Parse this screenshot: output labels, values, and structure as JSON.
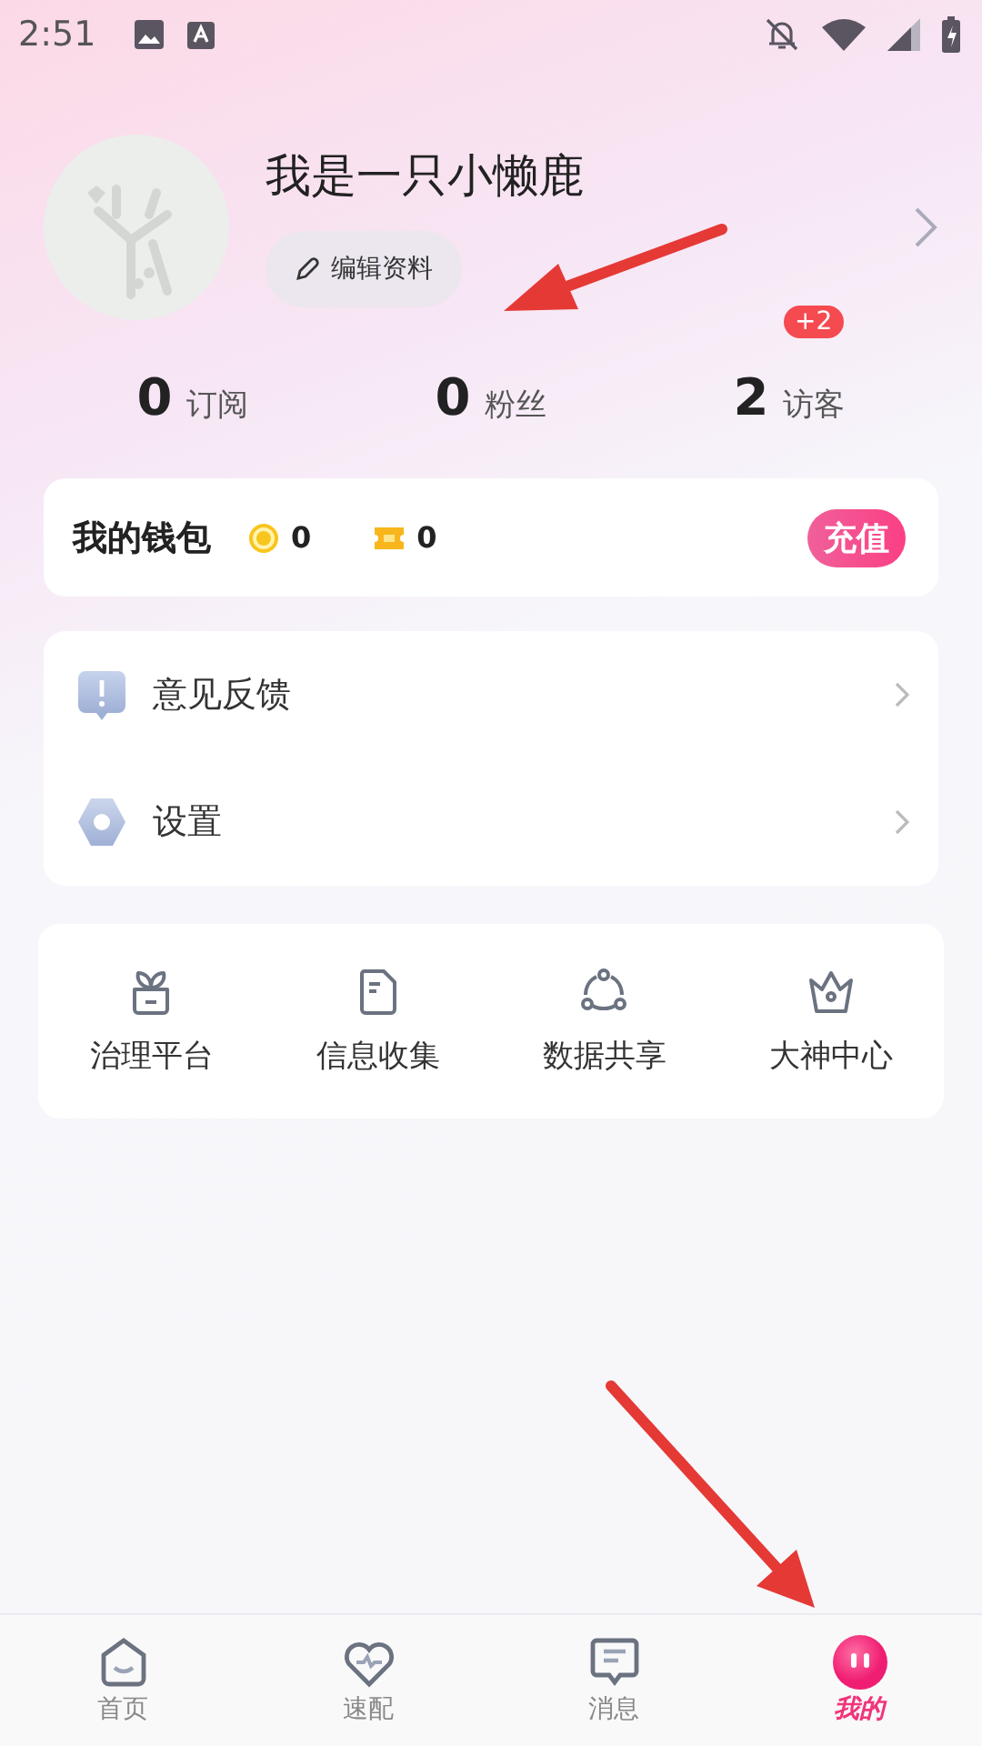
{
  "status_bar": {
    "time": "2:51"
  },
  "profile": {
    "name": "我是一只小懒鹿",
    "edit_button": "编辑资料"
  },
  "stats": [
    {
      "value": "0",
      "label": "订阅"
    },
    {
      "value": "0",
      "label": "粉丝"
    },
    {
      "value": "2",
      "label": "访客",
      "badge": "+2"
    }
  ],
  "wallet": {
    "title": "我的钱包",
    "balances": [
      {
        "kind": "coin",
        "value": "0"
      },
      {
        "kind": "ticket",
        "value": "0"
      }
    ],
    "button": "充值"
  },
  "menu": [
    {
      "kind": "feedback",
      "label": "意见反馈"
    },
    {
      "kind": "settings",
      "label": "设置"
    }
  ],
  "tools": [
    {
      "kind": "plant",
      "label": "治理平台"
    },
    {
      "kind": "document",
      "label": "信息收集"
    },
    {
      "kind": "share",
      "label": "数据共享"
    },
    {
      "kind": "crown",
      "label": "大神中心"
    }
  ],
  "nav": [
    {
      "kind": "home",
      "label": "首页",
      "selected": false
    },
    {
      "kind": "heart",
      "label": "速配",
      "selected": false
    },
    {
      "kind": "message",
      "label": "消息",
      "selected": false
    },
    {
      "kind": "me",
      "label": "我的",
      "selected": true
    }
  ]
}
